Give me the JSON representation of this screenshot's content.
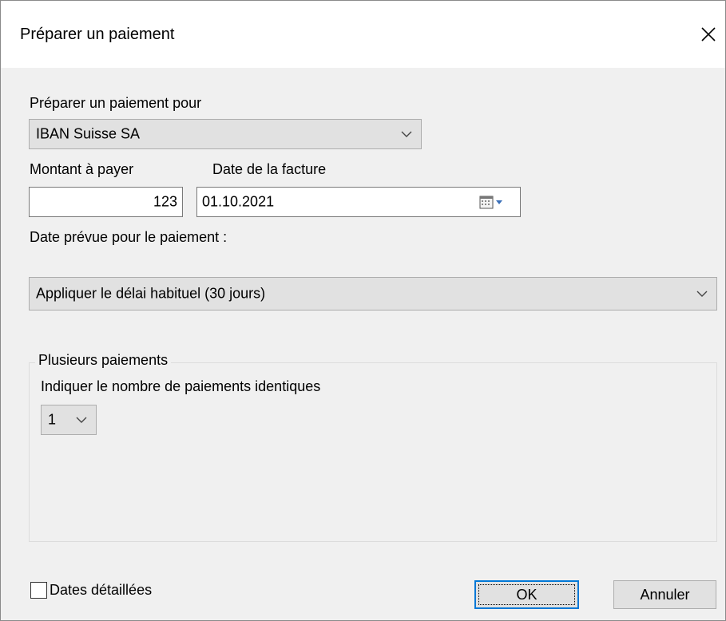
{
  "dialog": {
    "title": "Préparer un paiement"
  },
  "form": {
    "prepare_for_label": "Préparer un paiement pour",
    "prepare_for_value": "IBAN Suisse SA",
    "amount_label": "Montant à payer",
    "amount_value": "123",
    "invoice_date_label": "Date de la facture",
    "invoice_date_value": "01.10.2021",
    "planned_date_label": "Date prévue pour le paiement :",
    "planned_date_value": "Appliquer le délai habituel (30 jours)"
  },
  "multiple_payments": {
    "group_label": "Plusieurs paiements",
    "count_label": "Indiquer le nombre de paiements identiques",
    "count_value": "1"
  },
  "footer": {
    "detailed_dates_label": "Dates détaillées",
    "detailed_dates_checked": false,
    "ok_label": "OK",
    "cancel_label": "Annuler"
  },
  "icons": {
    "close": "close-icon",
    "dropdown": "chevron-down-icon",
    "calendar": "calendar-icon"
  },
  "colors": {
    "dialog_bg": "#f0f0f0",
    "title_bg": "#ffffff",
    "button_bg": "#e1e1e1",
    "default_button_border": "#0078d7"
  }
}
